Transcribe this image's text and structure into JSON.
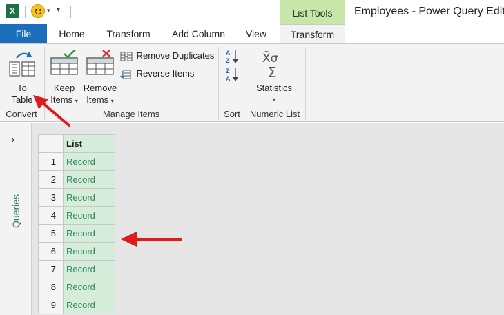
{
  "titlebar": {
    "app_icon": "excel-icon",
    "qa_more": "▾",
    "context_group": "List Tools",
    "window_title": "Employees - Power Query Editor"
  },
  "tabs": [
    {
      "label": "File"
    },
    {
      "label": "Home"
    },
    {
      "label": "Transform"
    },
    {
      "label": "Add Column"
    },
    {
      "label": "View"
    },
    {
      "label": "Transform"
    }
  ],
  "ribbon": {
    "convert": {
      "to_table_line1": "To",
      "to_table_line2": "Table",
      "group_label": "Convert"
    },
    "manage_items": {
      "keep_line1": "Keep",
      "keep_line2": "Items",
      "remove_line1": "Remove",
      "remove_line2": "Items",
      "remove_duplicates": "Remove Duplicates",
      "reverse_items": "Reverse Items",
      "group_label": "Manage Items"
    },
    "sort": {
      "group_label": "Sort"
    },
    "numeric_list": {
      "statistics": "Statistics",
      "group_label": "Numeric List"
    }
  },
  "rail": {
    "chevron": "›",
    "label": "Queries"
  },
  "grid": {
    "header": "List",
    "rows": [
      {
        "index": "1",
        "value": "Record"
      },
      {
        "index": "2",
        "value": "Record"
      },
      {
        "index": "3",
        "value": "Record"
      },
      {
        "index": "4",
        "value": "Record"
      },
      {
        "index": "5",
        "value": "Record"
      },
      {
        "index": "6",
        "value": "Record"
      },
      {
        "index": "7",
        "value": "Record"
      },
      {
        "index": "8",
        "value": "Record"
      },
      {
        "index": "9",
        "value": "Record"
      }
    ]
  },
  "colors": {
    "accent_file": "#1a6ebc",
    "context_green": "#c6e7a8",
    "excel_green": "#1e7145",
    "record_text": "#2e8b57",
    "annotation_red": "#e01b1b"
  }
}
